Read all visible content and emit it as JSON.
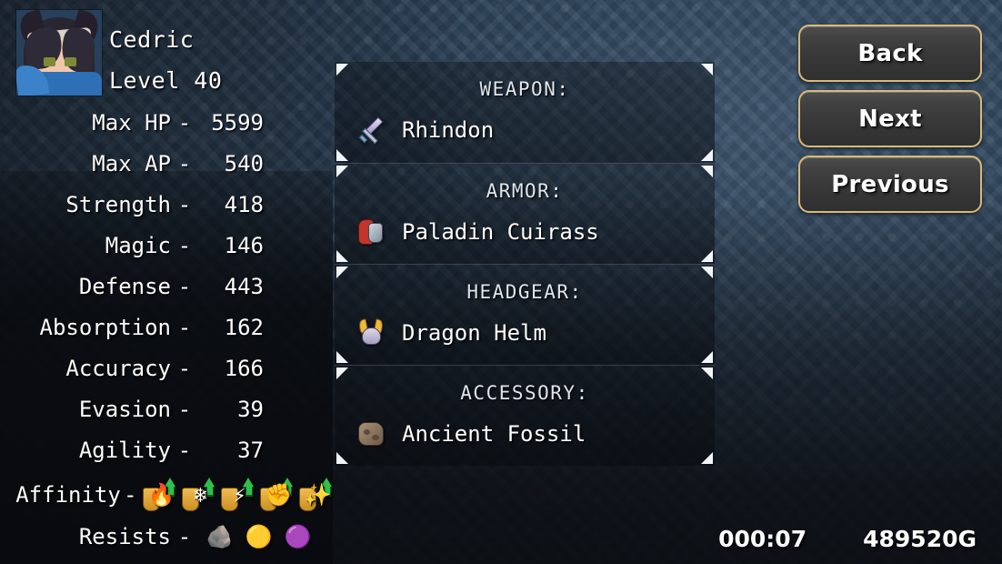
{
  "character": {
    "portrait_alt": "cedric-portrait",
    "name": "Cedric",
    "level_label": "Level 40"
  },
  "stats": [
    {
      "label": "Max HP",
      "dash": "-",
      "value": "5599"
    },
    {
      "label": "Max AP",
      "dash": "-",
      "value": "540"
    },
    {
      "label": "Strength",
      "dash": "-",
      "value": "418"
    },
    {
      "label": "Magic",
      "dash": "-",
      "value": "146"
    },
    {
      "label": "Defense",
      "dash": "-",
      "value": "443"
    },
    {
      "label": "Absorption",
      "dash": "-",
      "value": "162"
    },
    {
      "label": "Accuracy",
      "dash": "-",
      "value": "166"
    },
    {
      "label": "Evasion",
      "dash": "-",
      "value": "39"
    },
    {
      "label": "Agility",
      "dash": "-",
      "value": "37"
    }
  ],
  "affinity": {
    "label": "Affinity",
    "dash": "-",
    "icons": [
      {
        "name": "fire-affinity-icon",
        "glyph": "🔥",
        "arrow": "up"
      },
      {
        "name": "ice-affinity-icon",
        "glyph": "❄",
        "arrow": "up"
      },
      {
        "name": "lightning-affinity-icon",
        "glyph": "⚡",
        "arrow": "up"
      },
      {
        "name": "earth-affinity-icon",
        "glyph": "✊",
        "arrow": "up"
      },
      {
        "name": "holy-affinity-icon",
        "glyph": "✨",
        "arrow": "up"
      }
    ]
  },
  "resists": {
    "label": "Resists",
    "dash": "-",
    "icons": [
      {
        "name": "petrify-resist-icon",
        "glyph": "🪨"
      },
      {
        "name": "silence-resist-icon",
        "glyph": "🟡"
      },
      {
        "name": "poison-resist-icon",
        "glyph": "🟣"
      }
    ]
  },
  "equipment": [
    {
      "slot_name": "weapon-slot",
      "title": "WEAPON:",
      "icon": "sword-icon",
      "item": "Rhindon"
    },
    {
      "slot_name": "armor-slot",
      "title": "ARMOR:",
      "icon": "armor-icon",
      "item": "Paladin Cuirass"
    },
    {
      "slot_name": "headgear-slot",
      "title": "HEADGEAR:",
      "icon": "helm-icon",
      "item": "Dragon Helm"
    },
    {
      "slot_name": "accessory-slot",
      "title": "ACCESSORY:",
      "icon": "fossil-icon",
      "item": "Ancient Fossil"
    }
  ],
  "buttons": [
    {
      "name": "back-button",
      "label": "Back"
    },
    {
      "name": "next-button",
      "label": "Next"
    },
    {
      "name": "previous-button",
      "label": "Previous"
    }
  ],
  "status": {
    "play_time": "000:07",
    "gold": "489520G"
  },
  "colors": {
    "background_blue": "#2b4055",
    "panel_dark": "#1b1f24",
    "button_border_gold": "#d8b97a",
    "button_fill": "#3a3a3a",
    "text_white": "#ffffff",
    "affinity_arrow_green": "#2fc04a",
    "shield_gold": "#f0bc4e"
  }
}
